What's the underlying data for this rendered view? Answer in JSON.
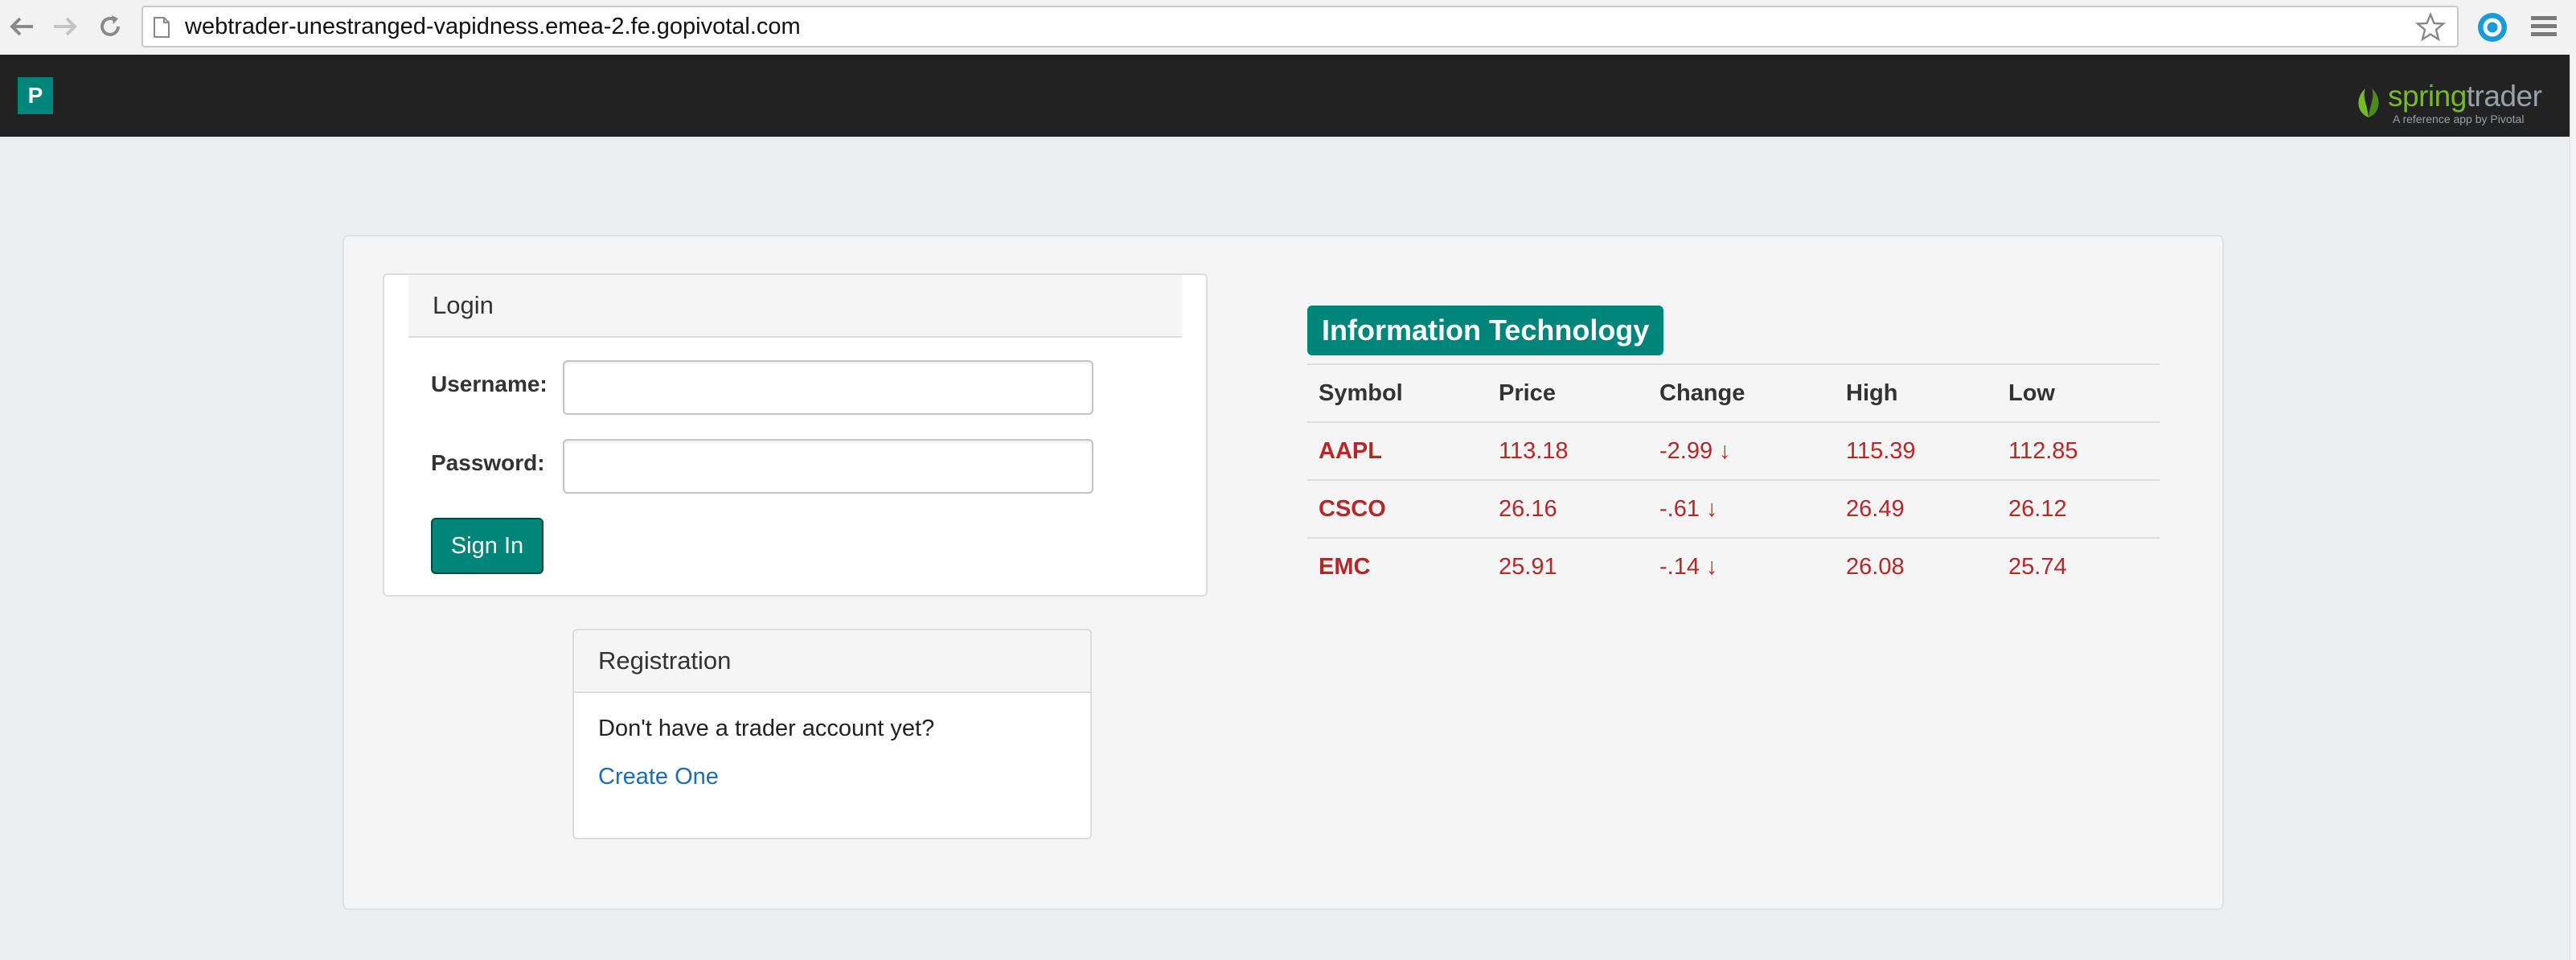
{
  "browser": {
    "url": "webtrader-unestranged-vapidness.emea-2.fe.gopivotal.com"
  },
  "navbar": {
    "brand_letter": "P",
    "logo_part1": "spring",
    "logo_part2": "trader",
    "logo_tagline": "A reference app by Pivotal"
  },
  "login": {
    "title": "Login",
    "username_label": "Username:",
    "password_label": "Password:",
    "username_value": "",
    "password_value": "",
    "submit_label": "Sign In"
  },
  "registration": {
    "title": "Registration",
    "prompt": "Don't have a trader account yet?",
    "link_label": "Create One"
  },
  "market": {
    "sector": "Information Technology",
    "columns": [
      "Symbol",
      "Price",
      "Change",
      "High",
      "Low"
    ],
    "rows": [
      {
        "symbol": "AAPL",
        "price": "113.18",
        "change": "-2.99 ↓",
        "high": "115.39",
        "low": "112.85"
      },
      {
        "symbol": "CSCO",
        "price": "26.16",
        "change": "-.61 ↓",
        "high": "26.49",
        "low": "26.12"
      },
      {
        "symbol": "EMC",
        "price": "25.91",
        "change": "-.14 ↓",
        "high": "26.08",
        "low": "25.74"
      }
    ],
    "negative_color": "#b32828"
  },
  "colors": {
    "brand": "#00857a",
    "navbar": "#222222",
    "link": "#1a6fb3"
  },
  "icons": [
    "back-arrow-icon",
    "forward-arrow-icon",
    "reload-icon",
    "page-icon",
    "bookmark-star-icon",
    "extension-icon",
    "chrome-menu-icon",
    "springtrader-leaf-icon"
  ]
}
